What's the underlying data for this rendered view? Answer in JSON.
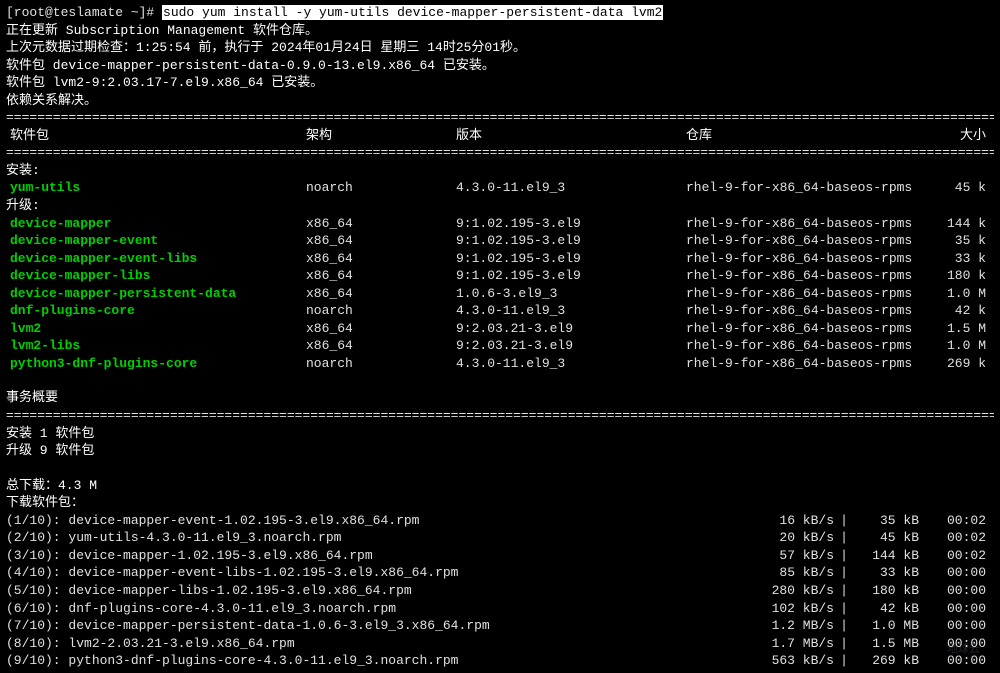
{
  "prompt": "[root@teslamate ~]# ",
  "command": "sudo yum install -y yum-utils device-mapper-persistent-data lvm2",
  "pre_lines": [
    "正在更新 Subscription Management 软件仓库。",
    "上次元数据过期检查：1:25:54 前，执行于 2024年01月24日 星期三 14时25分01秒。",
    "软件包 device-mapper-persistent-data-0.9.0-13.el9.x86_64 已安装。",
    "软件包 lvm2-9:2.03.17-7.el9.x86_64 已安装。",
    "依赖关系解决。"
  ],
  "headers": {
    "pkg": " 软件包",
    "arch": "架构",
    "ver": "版本",
    "repo": "仓库",
    "size": "大小"
  },
  "install_label": "安装:",
  "installs": [
    {
      "name": "yum-utils",
      "arch": "noarch",
      "ver": "4.3.0-11.el9_3",
      "repo": "rhel-9-for-x86_64-baseos-rpms",
      "size": "45 k"
    }
  ],
  "upgrade_label": "升级:",
  "upgrades": [
    {
      "name": "device-mapper",
      "arch": "x86_64",
      "ver": "9:1.02.195-3.el9",
      "repo": "rhel-9-for-x86_64-baseos-rpms",
      "size": "144 k"
    },
    {
      "name": "device-mapper-event",
      "arch": "x86_64",
      "ver": "9:1.02.195-3.el9",
      "repo": "rhel-9-for-x86_64-baseos-rpms",
      "size": "35 k"
    },
    {
      "name": "device-mapper-event-libs",
      "arch": "x86_64",
      "ver": "9:1.02.195-3.el9",
      "repo": "rhel-9-for-x86_64-baseos-rpms",
      "size": "33 k"
    },
    {
      "name": "device-mapper-libs",
      "arch": "x86_64",
      "ver": "9:1.02.195-3.el9",
      "repo": "rhel-9-for-x86_64-baseos-rpms",
      "size": "180 k"
    },
    {
      "name": "device-mapper-persistent-data",
      "arch": "x86_64",
      "ver": "1.0.6-3.el9_3",
      "repo": "rhel-9-for-x86_64-baseos-rpms",
      "size": "1.0 M"
    },
    {
      "name": "dnf-plugins-core",
      "arch": "noarch",
      "ver": "4.3.0-11.el9_3",
      "repo": "rhel-9-for-x86_64-baseos-rpms",
      "size": "42 k"
    },
    {
      "name": "lvm2",
      "arch": "x86_64",
      "ver": "9:2.03.21-3.el9",
      "repo": "rhel-9-for-x86_64-baseos-rpms",
      "size": "1.5 M"
    },
    {
      "name": "lvm2-libs",
      "arch": "x86_64",
      "ver": "9:2.03.21-3.el9",
      "repo": "rhel-9-for-x86_64-baseos-rpms",
      "size": "1.0 M"
    },
    {
      "name": "python3-dnf-plugins-core",
      "arch": "noarch",
      "ver": "4.3.0-11.el9_3",
      "repo": "rhel-9-for-x86_64-baseos-rpms",
      "size": "269 k"
    }
  ],
  "summary_label": "事务概要",
  "summary_lines": [
    "安装  1 软件包",
    "升级  9 软件包"
  ],
  "total_download": "总下载：4.3 M",
  "download_label": "下载软件包：",
  "downloads": [
    {
      "idx": "(1/10): ",
      "name": "device-mapper-event-1.02.195-3.el9.x86_64.rpm",
      "speed": "16 kB/s",
      "size": "35 kB",
      "time": "00:02"
    },
    {
      "idx": "(2/10): ",
      "name": "yum-utils-4.3.0-11.el9_3.noarch.rpm",
      "speed": "20 kB/s",
      "size": "45 kB",
      "time": "00:02"
    },
    {
      "idx": "(3/10): ",
      "name": "device-mapper-1.02.195-3.el9.x86_64.rpm",
      "speed": "57 kB/s",
      "size": "144 kB",
      "time": "00:02"
    },
    {
      "idx": "(4/10): ",
      "name": "device-mapper-event-libs-1.02.195-3.el9.x86_64.rpm",
      "speed": "85 kB/s",
      "size": "33 kB",
      "time": "00:00"
    },
    {
      "idx": "(5/10): ",
      "name": "device-mapper-libs-1.02.195-3.el9.x86_64.rpm",
      "speed": "280 kB/s",
      "size": "180 kB",
      "time": "00:00"
    },
    {
      "idx": "(6/10): ",
      "name": "dnf-plugins-core-4.3.0-11.el9_3.noarch.rpm",
      "speed": "102 kB/s",
      "size": "42 kB",
      "time": "00:00"
    },
    {
      "idx": "(7/10): ",
      "name": "device-mapper-persistent-data-1.0.6-3.el9_3.x86_64.rpm",
      "speed": "1.2 MB/s",
      "size": "1.0 MB",
      "time": "00:00"
    },
    {
      "idx": "(8/10): ",
      "name": "lvm2-2.03.21-3.el9.x86_64.rpm",
      "speed": "1.7 MB/s",
      "size": "1.5 MB",
      "time": "00:00"
    },
    {
      "idx": "(9/10): ",
      "name": "python3-dnf-plugins-core-4.3.0-11.el9_3.noarch.rpm",
      "speed": "563 kB/s",
      "size": "269 kB",
      "time": "00:00"
    }
  ],
  "divider": "================================================================================================================================================"
}
